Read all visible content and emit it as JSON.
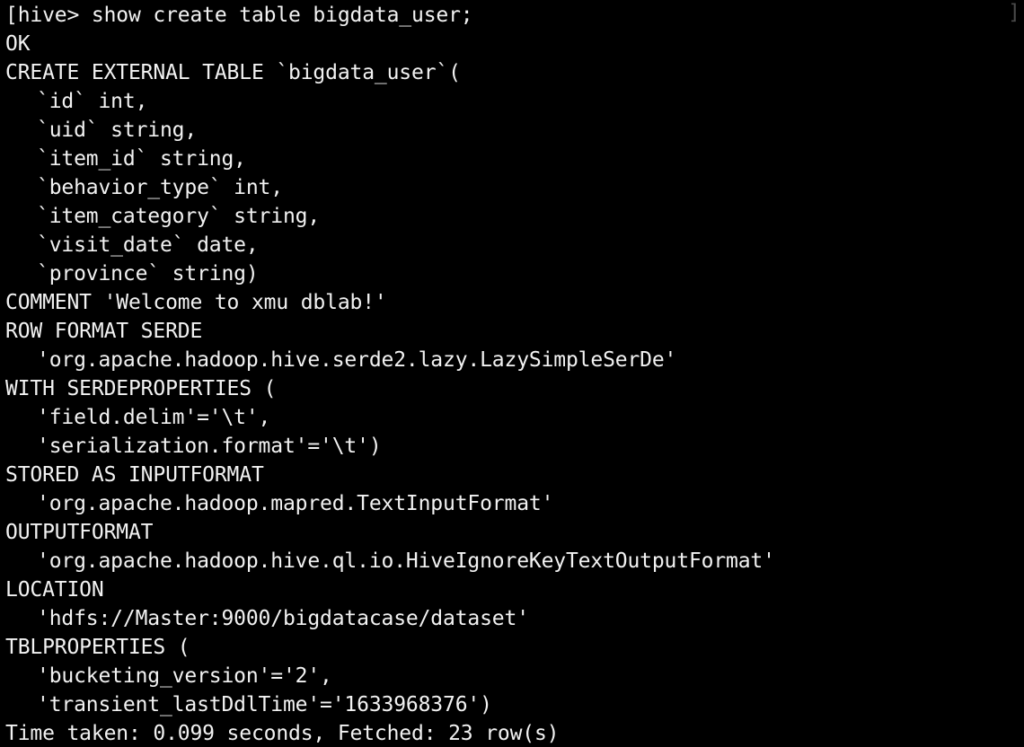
{
  "terminal": {
    "prompt": "hive>",
    "background_color": "#000000",
    "text_color": "#f2f2f2",
    "corner_artifact": "]",
    "corner_artifact_color": "#4a4a4a",
    "lines": [
      {
        "text": "[hive> show create table bigdata_user;",
        "indent": false
      },
      {
        "text": "OK",
        "indent": false
      },
      {
        "text": "CREATE EXTERNAL TABLE `bigdata_user`(",
        "indent": false
      },
      {
        "text": "`id` int,",
        "indent": true
      },
      {
        "text": "`uid` string,",
        "indent": true
      },
      {
        "text": "`item_id` string,",
        "indent": true
      },
      {
        "text": "`behavior_type` int,",
        "indent": true
      },
      {
        "text": "`item_category` string,",
        "indent": true
      },
      {
        "text": "`visit_date` date,",
        "indent": true
      },
      {
        "text": "`province` string)",
        "indent": true
      },
      {
        "text": "COMMENT 'Welcome to xmu dblab!'",
        "indent": false
      },
      {
        "text": "ROW FORMAT SERDE",
        "indent": false
      },
      {
        "text": "'org.apache.hadoop.hive.serde2.lazy.LazySimpleSerDe'",
        "indent": true
      },
      {
        "text": "WITH SERDEPROPERTIES (",
        "indent": false
      },
      {
        "text": "'field.delim'='\\t',",
        "indent": true
      },
      {
        "text": "'serialization.format'='\\t')",
        "indent": true
      },
      {
        "text": "STORED AS INPUTFORMAT",
        "indent": false
      },
      {
        "text": "'org.apache.hadoop.mapred.TextInputFormat'",
        "indent": true
      },
      {
        "text": "OUTPUTFORMAT",
        "indent": false
      },
      {
        "text": "'org.apache.hadoop.hive.ql.io.HiveIgnoreKeyTextOutputFormat'",
        "indent": true
      },
      {
        "text": "LOCATION",
        "indent": false
      },
      {
        "text": "'hdfs://Master:9000/bigdatacase/dataset'",
        "indent": true
      },
      {
        "text": "TBLPROPERTIES (",
        "indent": false
      },
      {
        "text": "'bucketing_version'='2',",
        "indent": true
      },
      {
        "text": "'transient_lastDdlTime'='1633968376')",
        "indent": true
      },
      {
        "text": "Time taken: 0.099 seconds, Fetched: 23 row(s)",
        "indent": false
      }
    ]
  }
}
